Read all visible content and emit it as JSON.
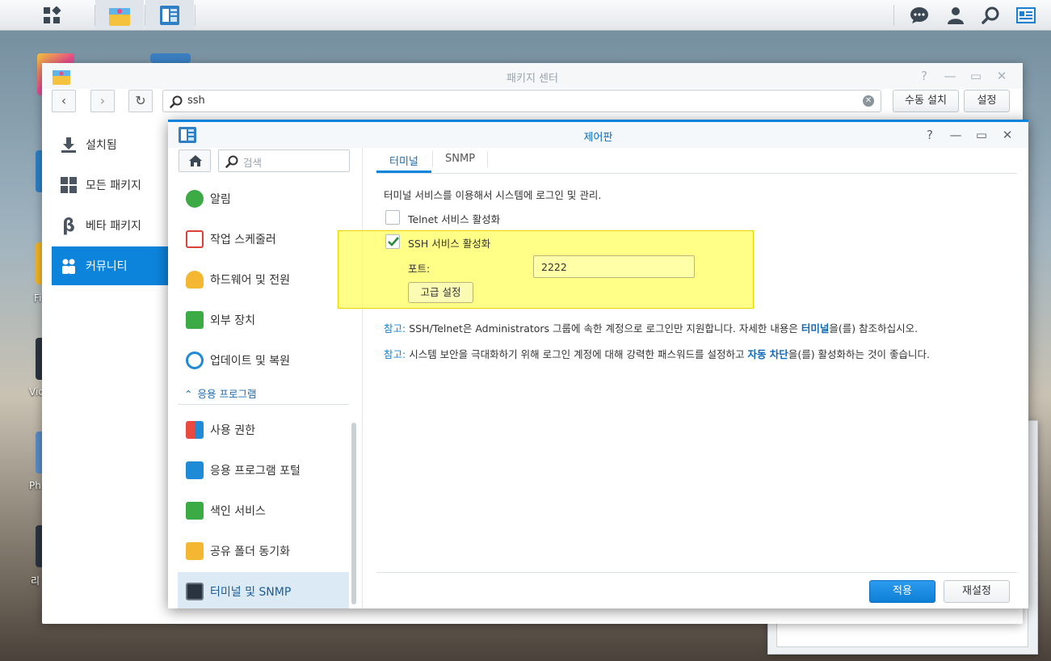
{
  "taskbar": {
    "icons": [
      "main-menu-icon",
      "package-center-app-icon",
      "control-panel-app-icon",
      "chat-icon",
      "user-icon",
      "search-icon",
      "widgets-icon"
    ]
  },
  "desktop": {
    "labels": [
      "Fi",
      "Vic",
      "Ph",
      "리"
    ]
  },
  "package_center": {
    "title": "패키지 센터",
    "search_value": "ssh",
    "manual_install_label": "수동 설치",
    "settings_label": "설정",
    "nav": [
      {
        "label": "설치됨",
        "icon": "download-icon"
      },
      {
        "label": "모든 패키지",
        "icon": "grid-icon"
      },
      {
        "label": "베타 패키지",
        "icon": "beta-icon"
      },
      {
        "label": "커뮤니티",
        "icon": "community-icon"
      }
    ],
    "active_nav_index": 3
  },
  "control_panel": {
    "title": "제어판",
    "search_placeholder": "검색",
    "sidebar": [
      {
        "label": "알림",
        "icon": "chat-bubble-icon"
      },
      {
        "label": "작업 스케줄러",
        "icon": "calendar-icon"
      },
      {
        "label": "하드웨어 및 전원",
        "icon": "lightbulb-icon"
      },
      {
        "label": "외부 장치",
        "icon": "upload-icon"
      },
      {
        "label": "업데이트 및 복원",
        "icon": "refresh-icon"
      }
    ],
    "section_header": "응용 프로그램",
    "sidebar_apps": [
      {
        "label": "사용 권한",
        "icon": "permission-icon"
      },
      {
        "label": "응용 프로그램 포털",
        "icon": "portal-icon"
      },
      {
        "label": "색인 서비스",
        "icon": "search-index-icon"
      },
      {
        "label": "공유 폴더 동기화",
        "icon": "folder-sync-icon"
      },
      {
        "label": "터미널 및 SNMP",
        "icon": "terminal-icon"
      }
    ],
    "tabs": [
      "터미널",
      "SNMP"
    ],
    "active_tab_index": 0,
    "description": "터미널 서비스를 이용해서 시스템에 로그인 및 관리.",
    "telnet_label": "Telnet 서비스 활성화",
    "telnet_checked": false,
    "ssh_label": "SSH 서비스 활성화",
    "ssh_checked": true,
    "port_label": "포트:",
    "port_value": "2222",
    "advanced_label": "고급 설정",
    "note1": {
      "prefix": "참고:",
      "text_a": "SSH/Telnet은 Administrators 그룹에 속한 계정으로 로그인만 지원합니다. 자세한 내용은",
      "link": "터미널",
      "text_b": "을(를) 참조하십시오."
    },
    "note2": {
      "prefix": "참고:",
      "text_a": "시스템 보안을 극대화하기 위해 로그인 계정에 대해 강력한 패스워드를 설정하고",
      "link": "자동 차단",
      "text_b": "을(를) 활성화하는 것이 좋습니다."
    },
    "apply_label": "적용",
    "reset_label": "재설정",
    "highlight_color": "#ffff66",
    "accent_color": "#0d84db"
  }
}
